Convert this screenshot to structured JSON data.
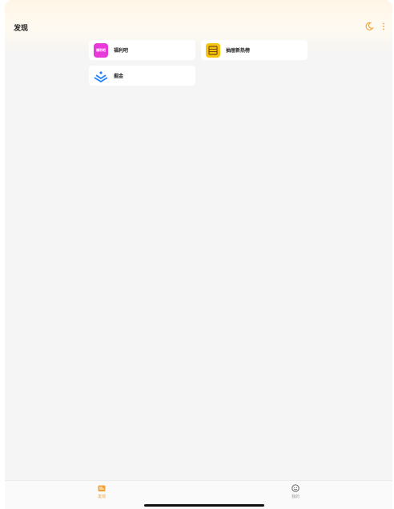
{
  "header": {
    "title": "发现"
  },
  "cards": [
    {
      "label": "福利吧",
      "logo_text": "福利吧",
      "logo_icon": "fulibar-logo-icon"
    },
    {
      "label": "抽屉新热榜",
      "logo_icon": "chouti-logo-icon"
    },
    {
      "label": "掘金",
      "logo_icon": "juejin-logo-icon"
    }
  ],
  "tabs": [
    {
      "label": "发现",
      "icon": "discover-icon",
      "active": true
    },
    {
      "label": "我的",
      "icon": "profile-icon",
      "active": false
    }
  ],
  "colors": {
    "accent": "#f0a23a",
    "pink": "#e83ad9",
    "yellow": "#f4c40f",
    "blue": "#1e80ff"
  }
}
